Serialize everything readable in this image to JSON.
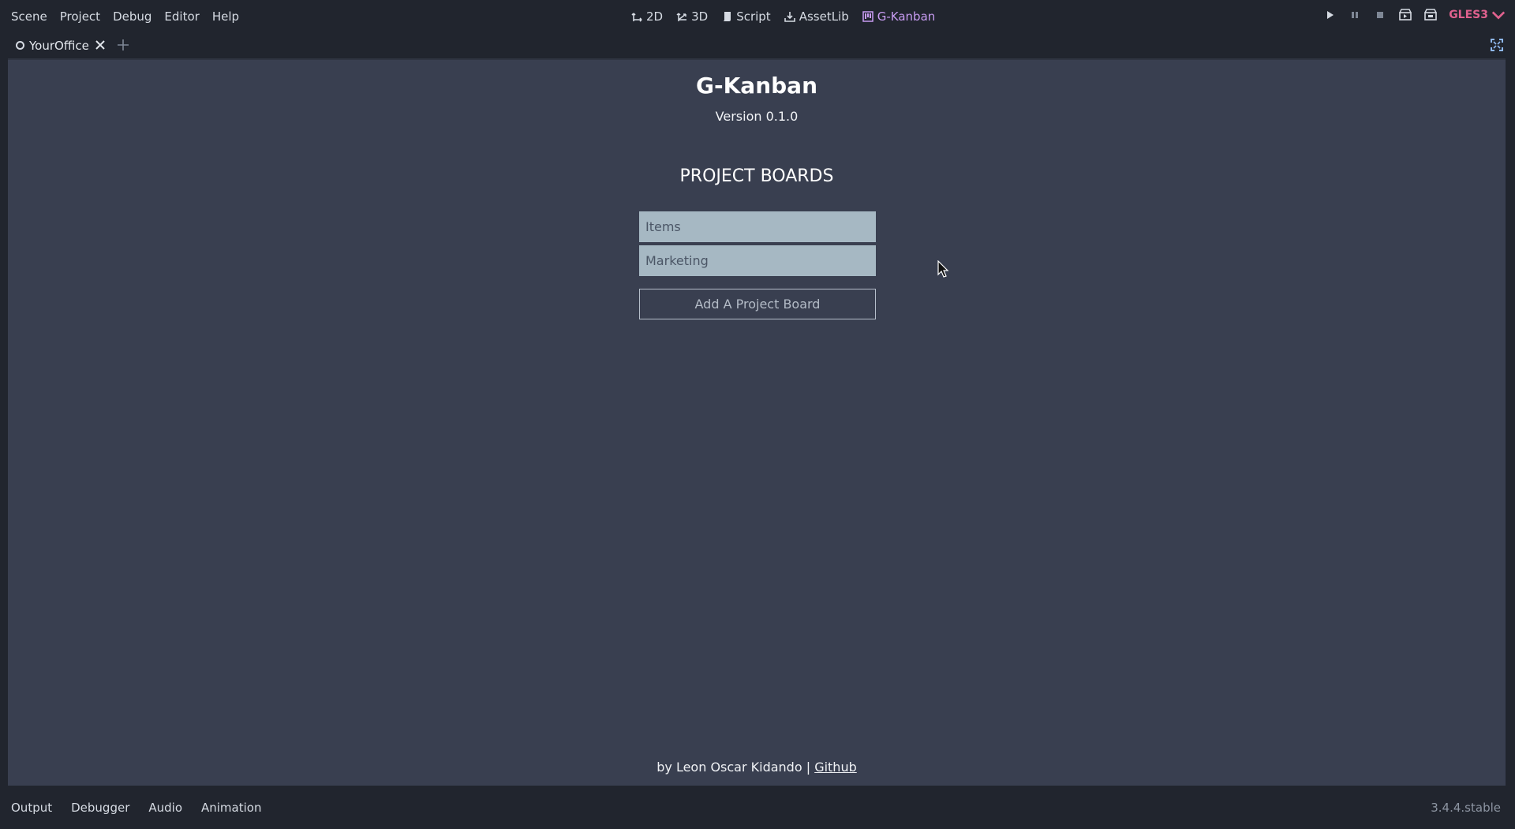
{
  "menu": [
    "Scene",
    "Project",
    "Debug",
    "Editor",
    "Help"
  ],
  "workspaces": [
    {
      "label": "2D",
      "icon": "2d-icon"
    },
    {
      "label": "3D",
      "icon": "3d-icon"
    },
    {
      "label": "Script",
      "icon": "script-icon"
    },
    {
      "label": "AssetLib",
      "icon": "assetlib-icon"
    },
    {
      "label": "G-Kanban",
      "icon": "kanban-icon",
      "active": true
    }
  ],
  "renderer": "GLES3",
  "scene_tab": {
    "label": "YourOffice"
  },
  "kanban": {
    "title": "G-Kanban",
    "version": "Version 0.1.0",
    "heading": "PROJECT BOARDS",
    "boards": [
      "Items",
      "Marketing"
    ],
    "add_button": "Add A Project Board",
    "footer_by": "by Leon Oscar Kidando | ",
    "footer_link": "Github"
  },
  "bottom_tabs": [
    "Output",
    "Debugger",
    "Audio",
    "Animation"
  ],
  "engine_version": "3.4.4.stable",
  "colors": {
    "editor_bg": "#21252e",
    "panel_bg": "#393f50",
    "board_item_bg": "#a6b8c3",
    "accent": "#c89cf2",
    "renderer": "#e0618e"
  }
}
